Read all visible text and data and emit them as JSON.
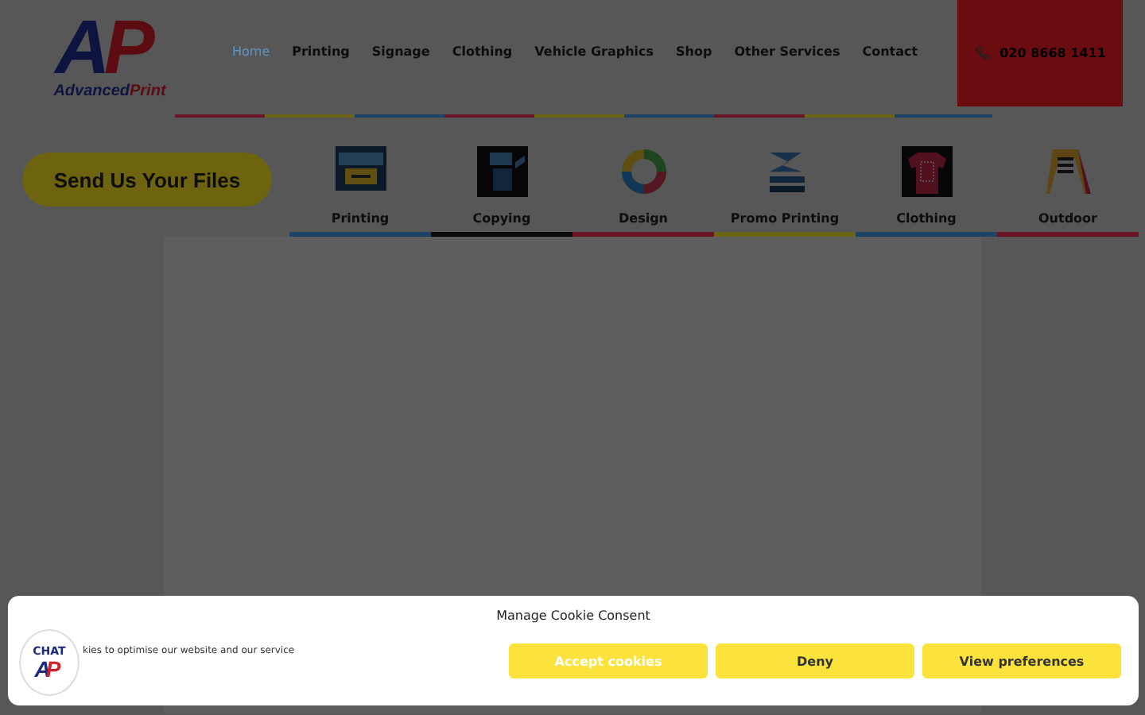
{
  "logo": {
    "initials": [
      "A",
      "P"
    ],
    "name": [
      "Advanced",
      "Print"
    ]
  },
  "nav": [
    {
      "label": "Home",
      "selected": true
    },
    {
      "label": "Printing",
      "selected": false
    },
    {
      "label": "Signage",
      "selected": false
    },
    {
      "label": "Clothing",
      "selected": false
    },
    {
      "label": "Vehicle Graphics",
      "selected": false
    },
    {
      "label": "Shop",
      "selected": false
    },
    {
      "label": "Other Services",
      "selected": false
    },
    {
      "label": "Contact",
      "selected": false
    }
  ],
  "phone": "020 8668 1411",
  "send_button": "Send Us Your Files",
  "services": [
    {
      "label": "Printing",
      "color": "#1d4466"
    },
    {
      "label": "Copying",
      "color": "#0a0a0a"
    },
    {
      "label": "Design",
      "color": "#6a1526"
    },
    {
      "label": "Promo Printing",
      "color": "#6e6416"
    },
    {
      "label": "Clothing",
      "color": "#1d4466"
    },
    {
      "label": "Outdoor",
      "color": "#6a1526"
    }
  ],
  "cookie_banner": {
    "title": "Manage Cookie Consent",
    "message": "kies to optimise our website and our service",
    "buttons": [
      "Accept cookies",
      "Deny",
      "View preferences"
    ]
  },
  "chat": {
    "label": "CHAT",
    "initials": [
      "A",
      "P"
    ]
  }
}
